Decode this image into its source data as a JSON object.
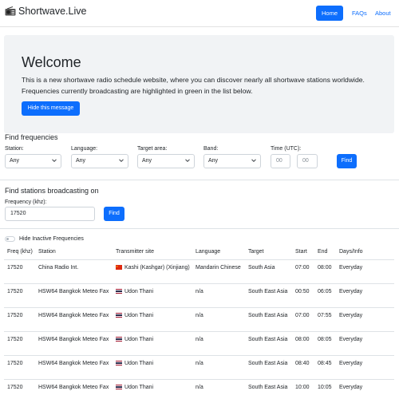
{
  "brand": {
    "name": "Shortwave.Live",
    "icon": "radio-icon"
  },
  "nav": {
    "home": "Home",
    "faqs": "FAQs",
    "about": "About"
  },
  "welcome": {
    "title": "Welcome",
    "text": "This is a new shortwave radio schedule website, where you can discover nearly all shortwave stations worldwide. Frequencies currently broadcasting are highlighted in green in the list below.",
    "hide_button": "Hide this message"
  },
  "find_frequencies": {
    "title": "Find frequencies",
    "station_label": "Station:",
    "station_value": "Any",
    "language_label": "Language:",
    "language_value": "Any",
    "target_label": "Target area:",
    "target_value": "Any",
    "band_label": "Band:",
    "band_value": "Any",
    "time_label": "Time (UTC):",
    "time_from_placeholder": "00",
    "time_to_placeholder": "00",
    "find_button": "Find"
  },
  "find_stations": {
    "title": "Find stations broadcasting on",
    "freq_label": "Frequency (khz):",
    "freq_value": "17520",
    "find_button": "Find"
  },
  "toggle_label": "Hide Inactive Frequencies",
  "table": {
    "headers": {
      "freq": "Freq (khz)",
      "station": "Station",
      "site": "Transmitter site",
      "language": "Language",
      "target": "Target",
      "start": "Start",
      "end": "End",
      "days": "Days/Info"
    },
    "rows": [
      {
        "freq": "17520",
        "station": "China Radio Int.",
        "flag": "china-flag-icon",
        "site": "Kashi (Kashgar) (Xinjiang)",
        "language": "Mandarin Chinese",
        "target": "South Asia",
        "start": "07:00",
        "end": "08:00",
        "days": "Everyday"
      },
      {
        "freq": "17520",
        "station": "HSW64 Bangkok Meteo Fax",
        "flag": "thailand-flag-icon",
        "site": "Udon Thani",
        "language": "n/a",
        "target": "South East Asia",
        "start": "00:50",
        "end": "06:05",
        "days": "Everyday"
      },
      {
        "freq": "17520",
        "station": "HSW64 Bangkok Meteo Fax",
        "flag": "thailand-flag-icon",
        "site": "Udon Thani",
        "language": "n/a",
        "target": "South East Asia",
        "start": "07:00",
        "end": "07:55",
        "days": "Everyday"
      },
      {
        "freq": "17520",
        "station": "HSW64 Bangkok Meteo Fax",
        "flag": "thailand-flag-icon",
        "site": "Udon Thani",
        "language": "n/a",
        "target": "South East Asia",
        "start": "08:00",
        "end": "08:05",
        "days": "Everyday"
      },
      {
        "freq": "17520",
        "station": "HSW64 Bangkok Meteo Fax",
        "flag": "thailand-flag-icon",
        "site": "Udon Thani",
        "language": "n/a",
        "target": "South East Asia",
        "start": "08:40",
        "end": "08:45",
        "days": "Everyday"
      },
      {
        "freq": "17520",
        "station": "HSW64 Bangkok Meteo Fax",
        "flag": "thailand-flag-icon",
        "site": "Udon Thani",
        "language": "n/a",
        "target": "South East Asia",
        "start": "10:00",
        "end": "10:05",
        "days": "Everyday"
      }
    ]
  },
  "colors": {
    "accent": "#0d6efd",
    "jumbotron": "#f1f3f5",
    "border": "#dee2e6"
  }
}
